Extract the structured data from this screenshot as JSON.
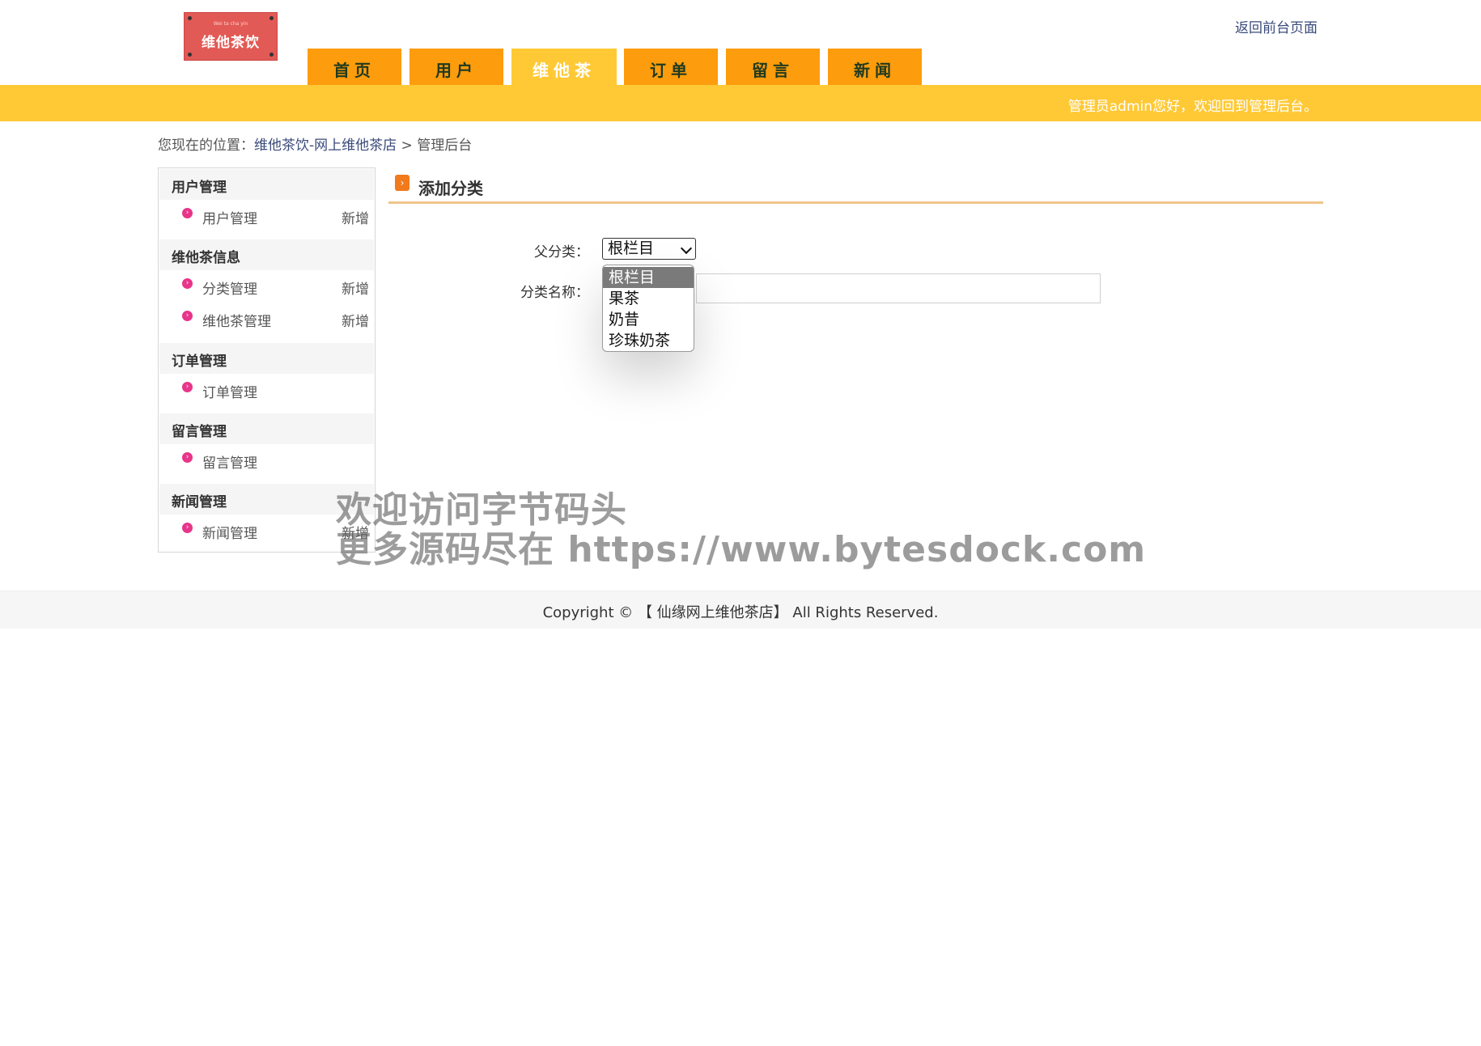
{
  "header": {
    "logo_small": "Wei ta cha yin",
    "logo_brand": "维他茶饮",
    "back_link": "返回前台页面",
    "welcome": "管理员admin您好，欢迎回到管理后台。"
  },
  "nav": {
    "tabs": [
      "首页",
      "用户",
      "维他茶",
      "订单",
      "留言",
      "新闻"
    ],
    "active": "维他茶"
  },
  "breadcrumb": {
    "prefix": "您现在的位置：",
    "site": "维他茶饮-网上维他茶店",
    "sep": " > ",
    "current": "管理后台"
  },
  "sidebar": {
    "groups": [
      {
        "title": "用户管理",
        "items": [
          {
            "label": "用户管理",
            "add": "新增"
          }
        ]
      },
      {
        "title": "维他茶信息",
        "items": [
          {
            "label": "分类管理",
            "add": "新增"
          },
          {
            "label": "维他茶管理",
            "add": "新增"
          }
        ]
      },
      {
        "title": "订单管理",
        "items": [
          {
            "label": "订单管理",
            "add": ""
          }
        ]
      },
      {
        "title": "留言管理",
        "items": [
          {
            "label": "留言管理",
            "add": ""
          }
        ]
      },
      {
        "title": "新闻管理",
        "items": [
          {
            "label": "新闻管理",
            "add": "新增"
          }
        ]
      }
    ]
  },
  "content": {
    "title": "添加分类",
    "parent_label": "父分类：",
    "parent_value": "根栏目",
    "name_label": "分类名称：",
    "name_value": "",
    "options": [
      "根栏目",
      "果茶",
      "奶昔",
      "珍珠奶茶"
    ],
    "selected_option": "根栏目"
  },
  "watermark": {
    "line1": "欢迎访问字节码头",
    "line2": "更多源码尽在  https://www.bytesdock.com"
  },
  "footer": {
    "text": "Copyright © 【 仙缘网上维他茶店】 All Rights Reserved."
  },
  "colors": {
    "tab": "#fd9c0c",
    "tab_active": "#ffc936",
    "banner": "#ffc936",
    "bullet": "#e8358a",
    "title_rule": "#f0c48a"
  }
}
